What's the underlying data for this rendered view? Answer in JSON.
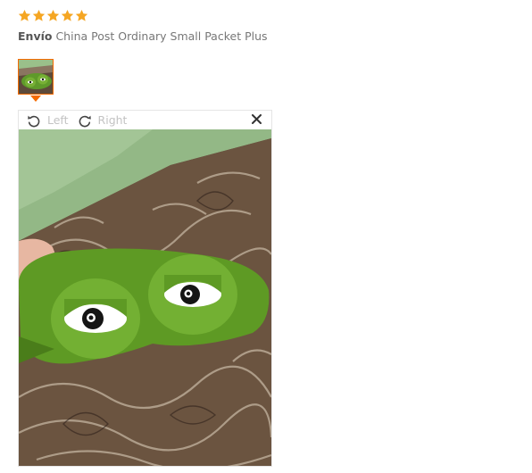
{
  "review": {
    "rating": 5,
    "rating_max": 5,
    "star_color": "#f5a623",
    "shipping_label": "Envío",
    "shipping_method": "China Post Ordinary Small Packet Plus"
  },
  "gallery": {
    "thumbnail_icon": "photo-thumbnail",
    "selected_border_color": "#f56a00"
  },
  "viewer": {
    "rotate_left_icon": "rotate-left-icon",
    "rotate_left_label": "Left",
    "rotate_right_icon": "rotate-right-icon",
    "rotate_right_label": "Right",
    "close_icon": "close-icon"
  }
}
